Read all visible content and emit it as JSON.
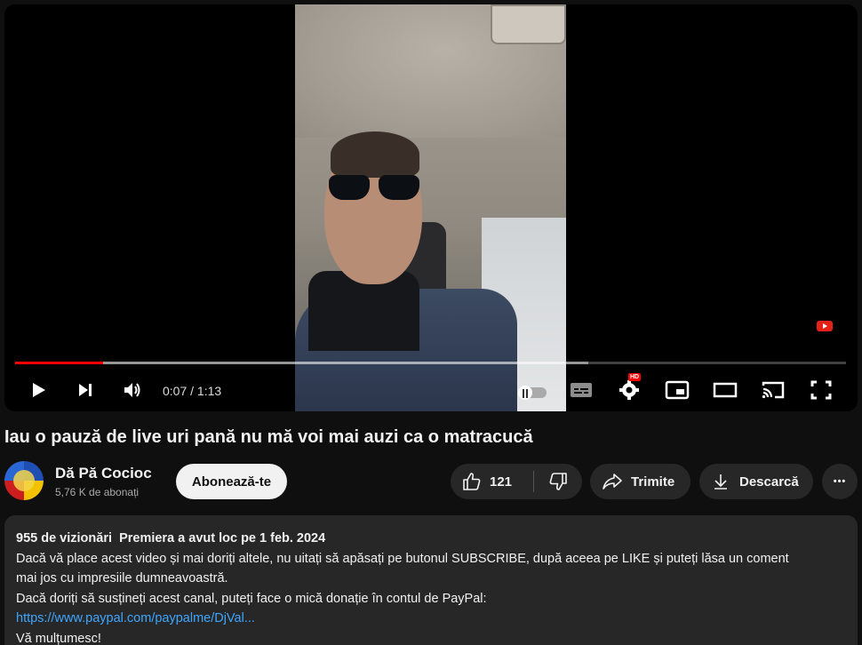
{
  "player": {
    "current_time": "0:07",
    "separator": " / ",
    "duration": "1:13",
    "played_fraction": 0.106,
    "buffered_fraction": 0.69,
    "hd_badge": "HD"
  },
  "video": {
    "title": "Iau o pauză de live uri pană nu mă voi mai auzi ca o matracucă"
  },
  "channel": {
    "name": "Dă Pă Cocioc",
    "subscribers": "5,76 K de abonați",
    "subscribe_label": "Abonează-te"
  },
  "actions": {
    "like_count": "121",
    "share_label": "Trimite",
    "download_label": "Descarcă",
    "more_label": "•••"
  },
  "description": {
    "views": "955 de vizionări",
    "premiere": "Premiera a avut loc pe 1 feb. 2024",
    "line1": "Dacă vă place acest video și mai doriți altele, nu uitați să apăsați pe butonul SUBSCRIBE, după aceea pe LIKE și puteți lăsa un coment",
    "line2": "mai jos cu impresiile dumneavoastră.",
    "line3": "Dacă doriți să susțineți acest canal, puteți face o mică donație în contul de PayPal:",
    "link": "https://www.paypal.com/paypalme/DjVal...",
    "line4": "Vă mulțumesc!"
  },
  "colors": {
    "accent": "#ff0000",
    "link": "#3ea6ff",
    "background": "#0f0f0f",
    "pill": "#272727"
  },
  "icons": [
    "play-icon",
    "next-icon",
    "volume-icon",
    "autoplay-toggle-icon",
    "subtitles-icon",
    "settings-icon",
    "miniplayer-icon",
    "theater-icon",
    "cast-icon",
    "fullscreen-icon",
    "like-icon",
    "dislike-icon",
    "share-icon",
    "download-icon",
    "more-icon"
  ]
}
